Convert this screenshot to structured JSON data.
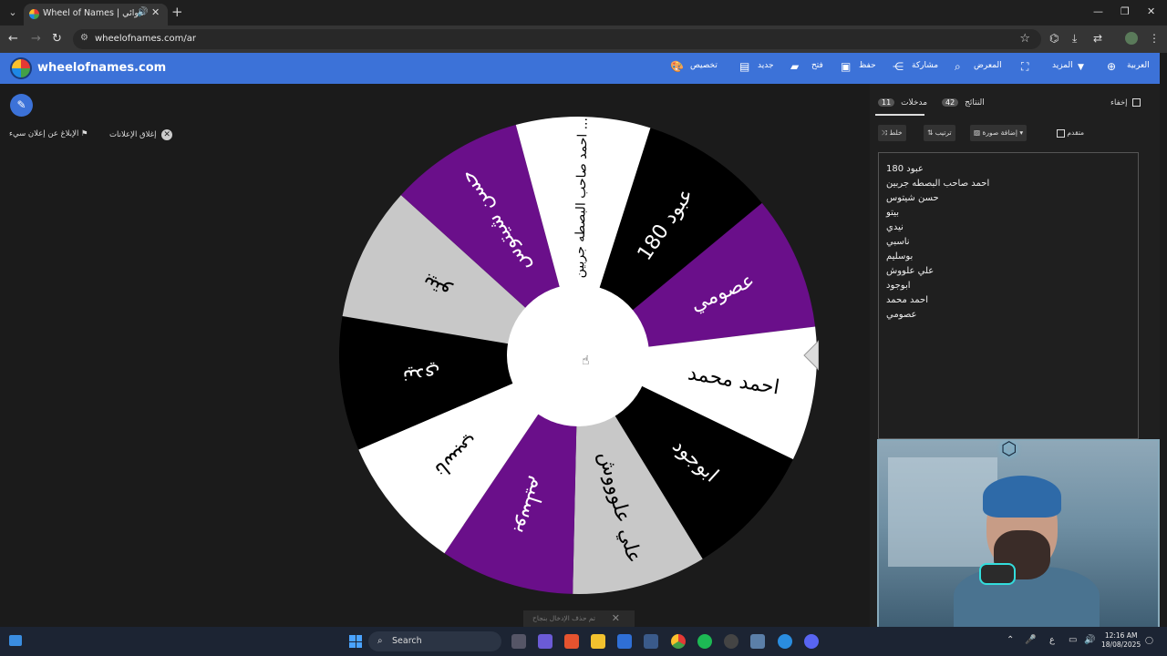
{
  "browser": {
    "tab_title": "Wheel of Names | العشوائي",
    "url": "wheelofnames.com/ar"
  },
  "header": {
    "site_name": "wheelofnames.com",
    "customize": "تخصيص",
    "new": "جديد",
    "open": "فتح",
    "save": "حفظ",
    "share": "مشاركة",
    "gallery": "المعرض",
    "more": "المزيد",
    "language": "العربية"
  },
  "page": {
    "report_ad": "الإبلاغ عن إعلان سيء",
    "close_ads": "إغلاق الإعلانات",
    "toast": "تم حذف الإدخال بنجاح"
  },
  "wheel": {
    "colors": [
      "#000000",
      "#6a0f8a",
      "#ffffff",
      "#000000",
      "#c8c8c8",
      "#6a0f8a",
      "#ffffff",
      "#000000",
      "#c8c8c8",
      "#6a0f8a",
      "#ffffff"
    ],
    "labels": [
      "عبود 180",
      "عصومي",
      "احمد محمد",
      "ابوجود",
      "علي علوووش",
      "بوسليم",
      "ناسبي",
      "نيدي",
      "بيتو",
      "حسن شيتوس",
      "احمد صاحب البصطه جربين ..."
    ]
  },
  "panel": {
    "hide_label": "إخفاء",
    "results_label": "النتائج",
    "results_count": "42",
    "entries_label": "مدخلات",
    "entries_count": "11",
    "shuffle": "خلط",
    "sort": "ترتيب",
    "add_image": "إضافة صورة",
    "advanced": "متقدم",
    "entries": [
      "عبود 180",
      "احمد صاحب البصطه جربين",
      "حسن شيتوس",
      "بيتو",
      "نيدي",
      "ناسبي",
      "بوسليم",
      "علي علووش",
      "ابوجود",
      "احمد محمد",
      "عصومي"
    ]
  },
  "taskbar": {
    "search_label": "Search",
    "time": "12:16 AM",
    "date": "18/08/2025",
    "lang": "ع"
  }
}
